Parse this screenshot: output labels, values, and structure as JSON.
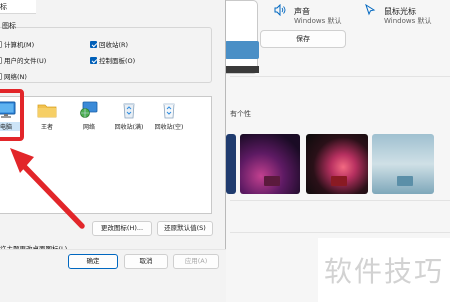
{
  "settings": {
    "sound": {
      "label": "声音",
      "value": "Windows 默认"
    },
    "cursor": {
      "label": "鼠标光标",
      "value": "Windows 默认"
    },
    "save_label": "保存",
    "themes_header": "有个性"
  },
  "dialog": {
    "title": "标",
    "group_label": "图标",
    "checkboxes": [
      {
        "label": "计算机(M)",
        "checked": false
      },
      {
        "label": "回收站(R)",
        "checked": true
      },
      {
        "label": "用户的文件(U)",
        "checked": false
      },
      {
        "label": "控制面板(O)",
        "checked": true
      },
      {
        "label": "网络(N)",
        "checked": false
      }
    ],
    "icons": [
      {
        "label": "电脑",
        "name": "computer-icon"
      },
      {
        "label": "王者",
        "name": "folder-icon"
      },
      {
        "label": "网络",
        "name": "network-icon"
      },
      {
        "label": "回收站(满)",
        "name": "recycle-bin-full-icon"
      },
      {
        "label": "回收站(空)",
        "name": "recycle-bin-empty-icon"
      }
    ],
    "change_icon_label": "更改图标(H)...",
    "restore_default_label": "还原默认值(S)",
    "allow_themes_label": "许主题更改桌面图标(L)",
    "ok_label": "确定",
    "cancel_label": "取消",
    "apply_label": "应用(A)"
  },
  "watermark": "软件技巧",
  "colors": {
    "accent": "#0067c0",
    "annotation": "#e2262a",
    "selection": "#cce4f7"
  }
}
